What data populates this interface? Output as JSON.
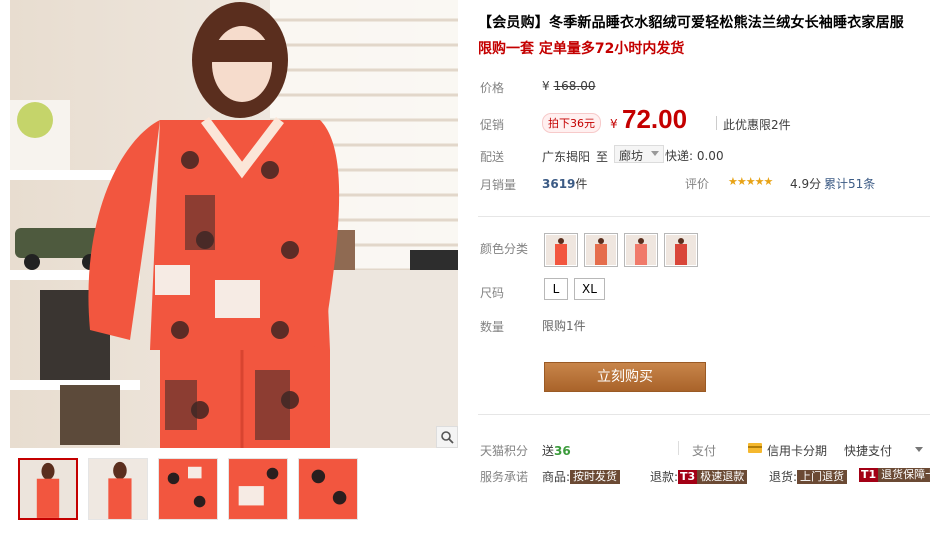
{
  "product": {
    "title": "【会员购】冬季新品睡衣水貂绒可爱轻松熊法兰绒女长袖睡衣家居服",
    "subtitle": "限购一套 定单量多72小时内发货"
  },
  "price": {
    "label": "价格",
    "currency": "¥",
    "original": "168.00"
  },
  "promo": {
    "label": "促销",
    "tag": "拍下36元",
    "currency": "¥",
    "value": "72.00",
    "limit_note": "此优惠限2件"
  },
  "shipping": {
    "label": "配送",
    "origin": "广东揭阳",
    "to": "至",
    "destination": "廊坊",
    "fee": "快递: 0.00"
  },
  "sales": {
    "label": "月销量",
    "count": "3619",
    "unit": "件"
  },
  "rating": {
    "label": "评价",
    "stars": "★★★★★",
    "score": "4.9分",
    "reviews": "累计51条"
  },
  "options": {
    "color_label": "颜色分类",
    "size_label": "尺码",
    "sizes": [
      "L",
      "XL"
    ],
    "qty_label": "数量",
    "qty_limit": "限购1件"
  },
  "buy_button": "立刻购买",
  "tmall_points": {
    "label": "天猫积分",
    "prefix": "送",
    "value": "36"
  },
  "payment": {
    "label": "支付",
    "credit": "信用卡分期",
    "quick": "快捷支付"
  },
  "service": {
    "label": "服务承诺",
    "goods_label": "商品:",
    "goods_tag": "按时发货",
    "refund_label": "退款:",
    "refund_t": "T3",
    "refund_tag": "极速退款",
    "return_label": "退货:",
    "return_tag": "上门退货",
    "return_t": "T1",
    "return_tag2": "退货保障卡"
  },
  "colors": {
    "accent": "#c40000",
    "buy_button": "#b76d2f",
    "link_blue": "#3c5b85",
    "points_green": "#3c9b3c",
    "garment": "#f2563f"
  },
  "icons": {
    "zoom": "magnifier-icon",
    "card": "credit-card-icon",
    "dropdown": "chevron-down-icon"
  }
}
